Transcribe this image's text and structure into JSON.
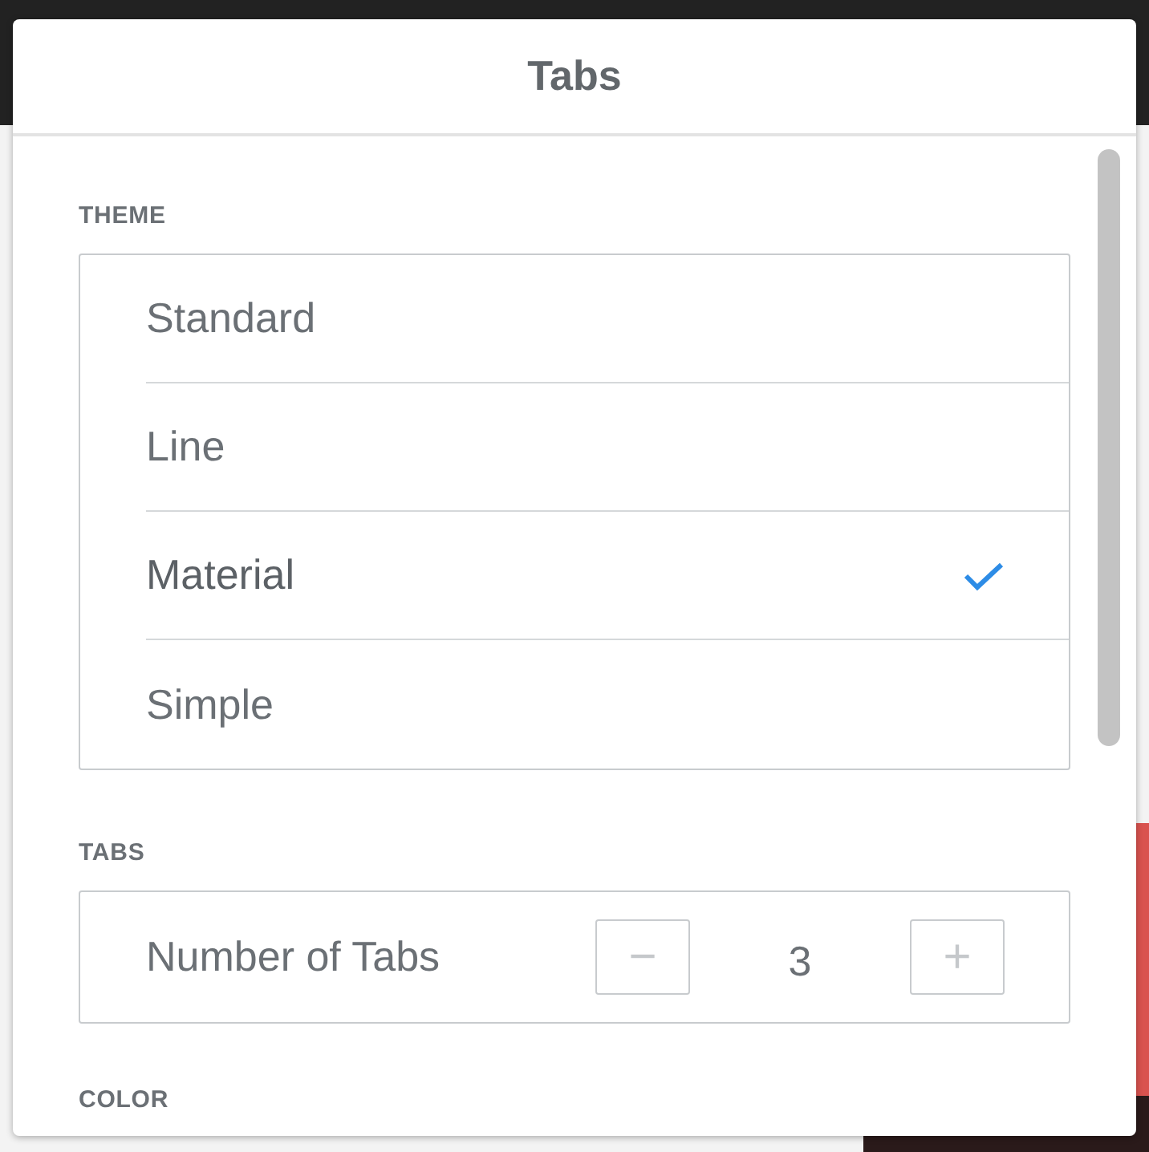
{
  "popover": {
    "title": "Tabs"
  },
  "sections": [
    {
      "kind": "list",
      "heading": "THEME",
      "options": [
        {
          "label": "Standard",
          "selected": false
        },
        {
          "label": "Line",
          "selected": false
        },
        {
          "label": "Material",
          "selected": true
        },
        {
          "label": "Simple",
          "selected": false
        }
      ]
    },
    {
      "kind": "stepper",
      "heading": "TABS",
      "label": "Number of Tabs",
      "value": "3",
      "decrement": "−",
      "increment": "+"
    },
    {
      "kind": "heading",
      "heading": "COLOR"
    }
  ]
}
